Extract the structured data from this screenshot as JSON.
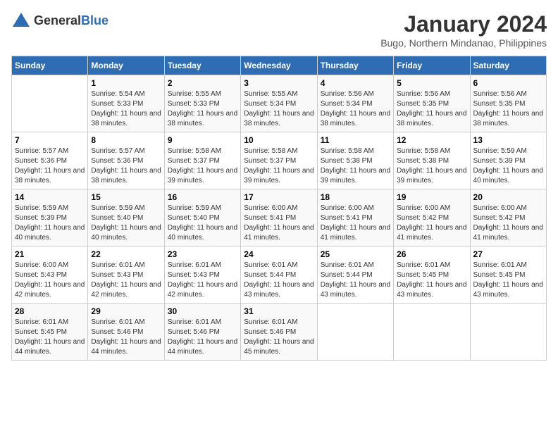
{
  "header": {
    "logo_general": "General",
    "logo_blue": "Blue",
    "title": "January 2024",
    "subtitle": "Bugo, Northern Mindanao, Philippines"
  },
  "days_of_week": [
    "Sunday",
    "Monday",
    "Tuesday",
    "Wednesday",
    "Thursday",
    "Friday",
    "Saturday"
  ],
  "weeks": [
    [
      {
        "day": "",
        "sunrise": "",
        "sunset": "",
        "daylight": ""
      },
      {
        "day": "1",
        "sunrise": "Sunrise: 5:54 AM",
        "sunset": "Sunset: 5:33 PM",
        "daylight": "Daylight: 11 hours and 38 minutes."
      },
      {
        "day": "2",
        "sunrise": "Sunrise: 5:55 AM",
        "sunset": "Sunset: 5:33 PM",
        "daylight": "Daylight: 11 hours and 38 minutes."
      },
      {
        "day": "3",
        "sunrise": "Sunrise: 5:55 AM",
        "sunset": "Sunset: 5:34 PM",
        "daylight": "Daylight: 11 hours and 38 minutes."
      },
      {
        "day": "4",
        "sunrise": "Sunrise: 5:56 AM",
        "sunset": "Sunset: 5:34 PM",
        "daylight": "Daylight: 11 hours and 38 minutes."
      },
      {
        "day": "5",
        "sunrise": "Sunrise: 5:56 AM",
        "sunset": "Sunset: 5:35 PM",
        "daylight": "Daylight: 11 hours and 38 minutes."
      },
      {
        "day": "6",
        "sunrise": "Sunrise: 5:56 AM",
        "sunset": "Sunset: 5:35 PM",
        "daylight": "Daylight: 11 hours and 38 minutes."
      }
    ],
    [
      {
        "day": "7",
        "sunrise": "Sunrise: 5:57 AM",
        "sunset": "Sunset: 5:36 PM",
        "daylight": "Daylight: 11 hours and 38 minutes."
      },
      {
        "day": "8",
        "sunrise": "Sunrise: 5:57 AM",
        "sunset": "Sunset: 5:36 PM",
        "daylight": "Daylight: 11 hours and 38 minutes."
      },
      {
        "day": "9",
        "sunrise": "Sunrise: 5:58 AM",
        "sunset": "Sunset: 5:37 PM",
        "daylight": "Daylight: 11 hours and 39 minutes."
      },
      {
        "day": "10",
        "sunrise": "Sunrise: 5:58 AM",
        "sunset": "Sunset: 5:37 PM",
        "daylight": "Daylight: 11 hours and 39 minutes."
      },
      {
        "day": "11",
        "sunrise": "Sunrise: 5:58 AM",
        "sunset": "Sunset: 5:38 PM",
        "daylight": "Daylight: 11 hours and 39 minutes."
      },
      {
        "day": "12",
        "sunrise": "Sunrise: 5:58 AM",
        "sunset": "Sunset: 5:38 PM",
        "daylight": "Daylight: 11 hours and 39 minutes."
      },
      {
        "day": "13",
        "sunrise": "Sunrise: 5:59 AM",
        "sunset": "Sunset: 5:39 PM",
        "daylight": "Daylight: 11 hours and 40 minutes."
      }
    ],
    [
      {
        "day": "14",
        "sunrise": "Sunrise: 5:59 AM",
        "sunset": "Sunset: 5:39 PM",
        "daylight": "Daylight: 11 hours and 40 minutes."
      },
      {
        "day": "15",
        "sunrise": "Sunrise: 5:59 AM",
        "sunset": "Sunset: 5:40 PM",
        "daylight": "Daylight: 11 hours and 40 minutes."
      },
      {
        "day": "16",
        "sunrise": "Sunrise: 5:59 AM",
        "sunset": "Sunset: 5:40 PM",
        "daylight": "Daylight: 11 hours and 40 minutes."
      },
      {
        "day": "17",
        "sunrise": "Sunrise: 6:00 AM",
        "sunset": "Sunset: 5:41 PM",
        "daylight": "Daylight: 11 hours and 41 minutes."
      },
      {
        "day": "18",
        "sunrise": "Sunrise: 6:00 AM",
        "sunset": "Sunset: 5:41 PM",
        "daylight": "Daylight: 11 hours and 41 minutes."
      },
      {
        "day": "19",
        "sunrise": "Sunrise: 6:00 AM",
        "sunset": "Sunset: 5:42 PM",
        "daylight": "Daylight: 11 hours and 41 minutes."
      },
      {
        "day": "20",
        "sunrise": "Sunrise: 6:00 AM",
        "sunset": "Sunset: 5:42 PM",
        "daylight": "Daylight: 11 hours and 41 minutes."
      }
    ],
    [
      {
        "day": "21",
        "sunrise": "Sunrise: 6:00 AM",
        "sunset": "Sunset: 5:43 PM",
        "daylight": "Daylight: 11 hours and 42 minutes."
      },
      {
        "day": "22",
        "sunrise": "Sunrise: 6:01 AM",
        "sunset": "Sunset: 5:43 PM",
        "daylight": "Daylight: 11 hours and 42 minutes."
      },
      {
        "day": "23",
        "sunrise": "Sunrise: 6:01 AM",
        "sunset": "Sunset: 5:43 PM",
        "daylight": "Daylight: 11 hours and 42 minutes."
      },
      {
        "day": "24",
        "sunrise": "Sunrise: 6:01 AM",
        "sunset": "Sunset: 5:44 PM",
        "daylight": "Daylight: 11 hours and 43 minutes."
      },
      {
        "day": "25",
        "sunrise": "Sunrise: 6:01 AM",
        "sunset": "Sunset: 5:44 PM",
        "daylight": "Daylight: 11 hours and 43 minutes."
      },
      {
        "day": "26",
        "sunrise": "Sunrise: 6:01 AM",
        "sunset": "Sunset: 5:45 PM",
        "daylight": "Daylight: 11 hours and 43 minutes."
      },
      {
        "day": "27",
        "sunrise": "Sunrise: 6:01 AM",
        "sunset": "Sunset: 5:45 PM",
        "daylight": "Daylight: 11 hours and 43 minutes."
      }
    ],
    [
      {
        "day": "28",
        "sunrise": "Sunrise: 6:01 AM",
        "sunset": "Sunset: 5:45 PM",
        "daylight": "Daylight: 11 hours and 44 minutes."
      },
      {
        "day": "29",
        "sunrise": "Sunrise: 6:01 AM",
        "sunset": "Sunset: 5:46 PM",
        "daylight": "Daylight: 11 hours and 44 minutes."
      },
      {
        "day": "30",
        "sunrise": "Sunrise: 6:01 AM",
        "sunset": "Sunset: 5:46 PM",
        "daylight": "Daylight: 11 hours and 44 minutes."
      },
      {
        "day": "31",
        "sunrise": "Sunrise: 6:01 AM",
        "sunset": "Sunset: 5:46 PM",
        "daylight": "Daylight: 11 hours and 45 minutes."
      },
      {
        "day": "",
        "sunrise": "",
        "sunset": "",
        "daylight": ""
      },
      {
        "day": "",
        "sunrise": "",
        "sunset": "",
        "daylight": ""
      },
      {
        "day": "",
        "sunrise": "",
        "sunset": "",
        "daylight": ""
      }
    ]
  ]
}
